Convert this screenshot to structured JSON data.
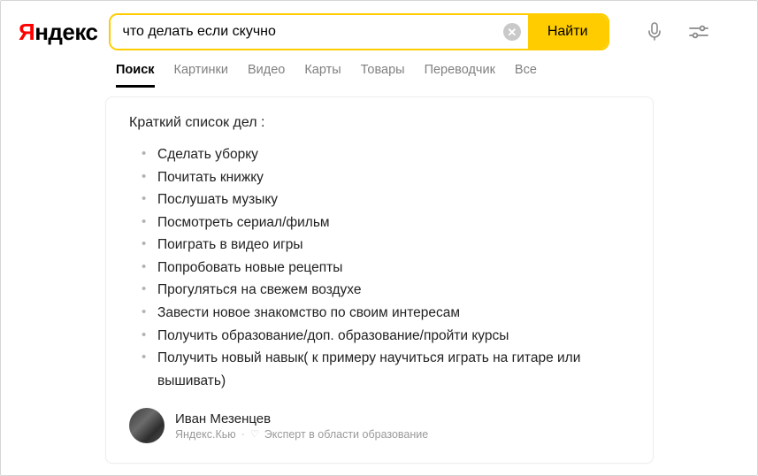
{
  "logo": {
    "prefix": "Я",
    "rest": "ндекс"
  },
  "search": {
    "value": "что делать если скучно",
    "button": "Найти"
  },
  "tabs": [
    {
      "label": "Поиск",
      "active": true
    },
    {
      "label": "Картинки",
      "active": false
    },
    {
      "label": "Видео",
      "active": false
    },
    {
      "label": "Карты",
      "active": false
    },
    {
      "label": "Товары",
      "active": false
    },
    {
      "label": "Переводчик",
      "active": false
    },
    {
      "label": "Все",
      "active": false
    }
  ],
  "answer": {
    "title": "Краткий список дел :",
    "items": [
      "Сделать уборку",
      "Почитать книжку",
      "Послушать музыку",
      "Посмотреть сериал/фильм",
      "Поиграть в видео игры",
      "Попробовать новые рецепты",
      "Прогуляться на свежем воздухе",
      "Завести новое знакомство по своим интересам",
      "Получить образование/доп. образование/пройти курсы",
      "Получить новый навык( к примеру научиться играть на гитаре или вышивать)"
    ],
    "author": {
      "name": "Иван Мезенцев",
      "source": "Яндекс.Кью",
      "badge": "Эксперт в области образование"
    }
  }
}
